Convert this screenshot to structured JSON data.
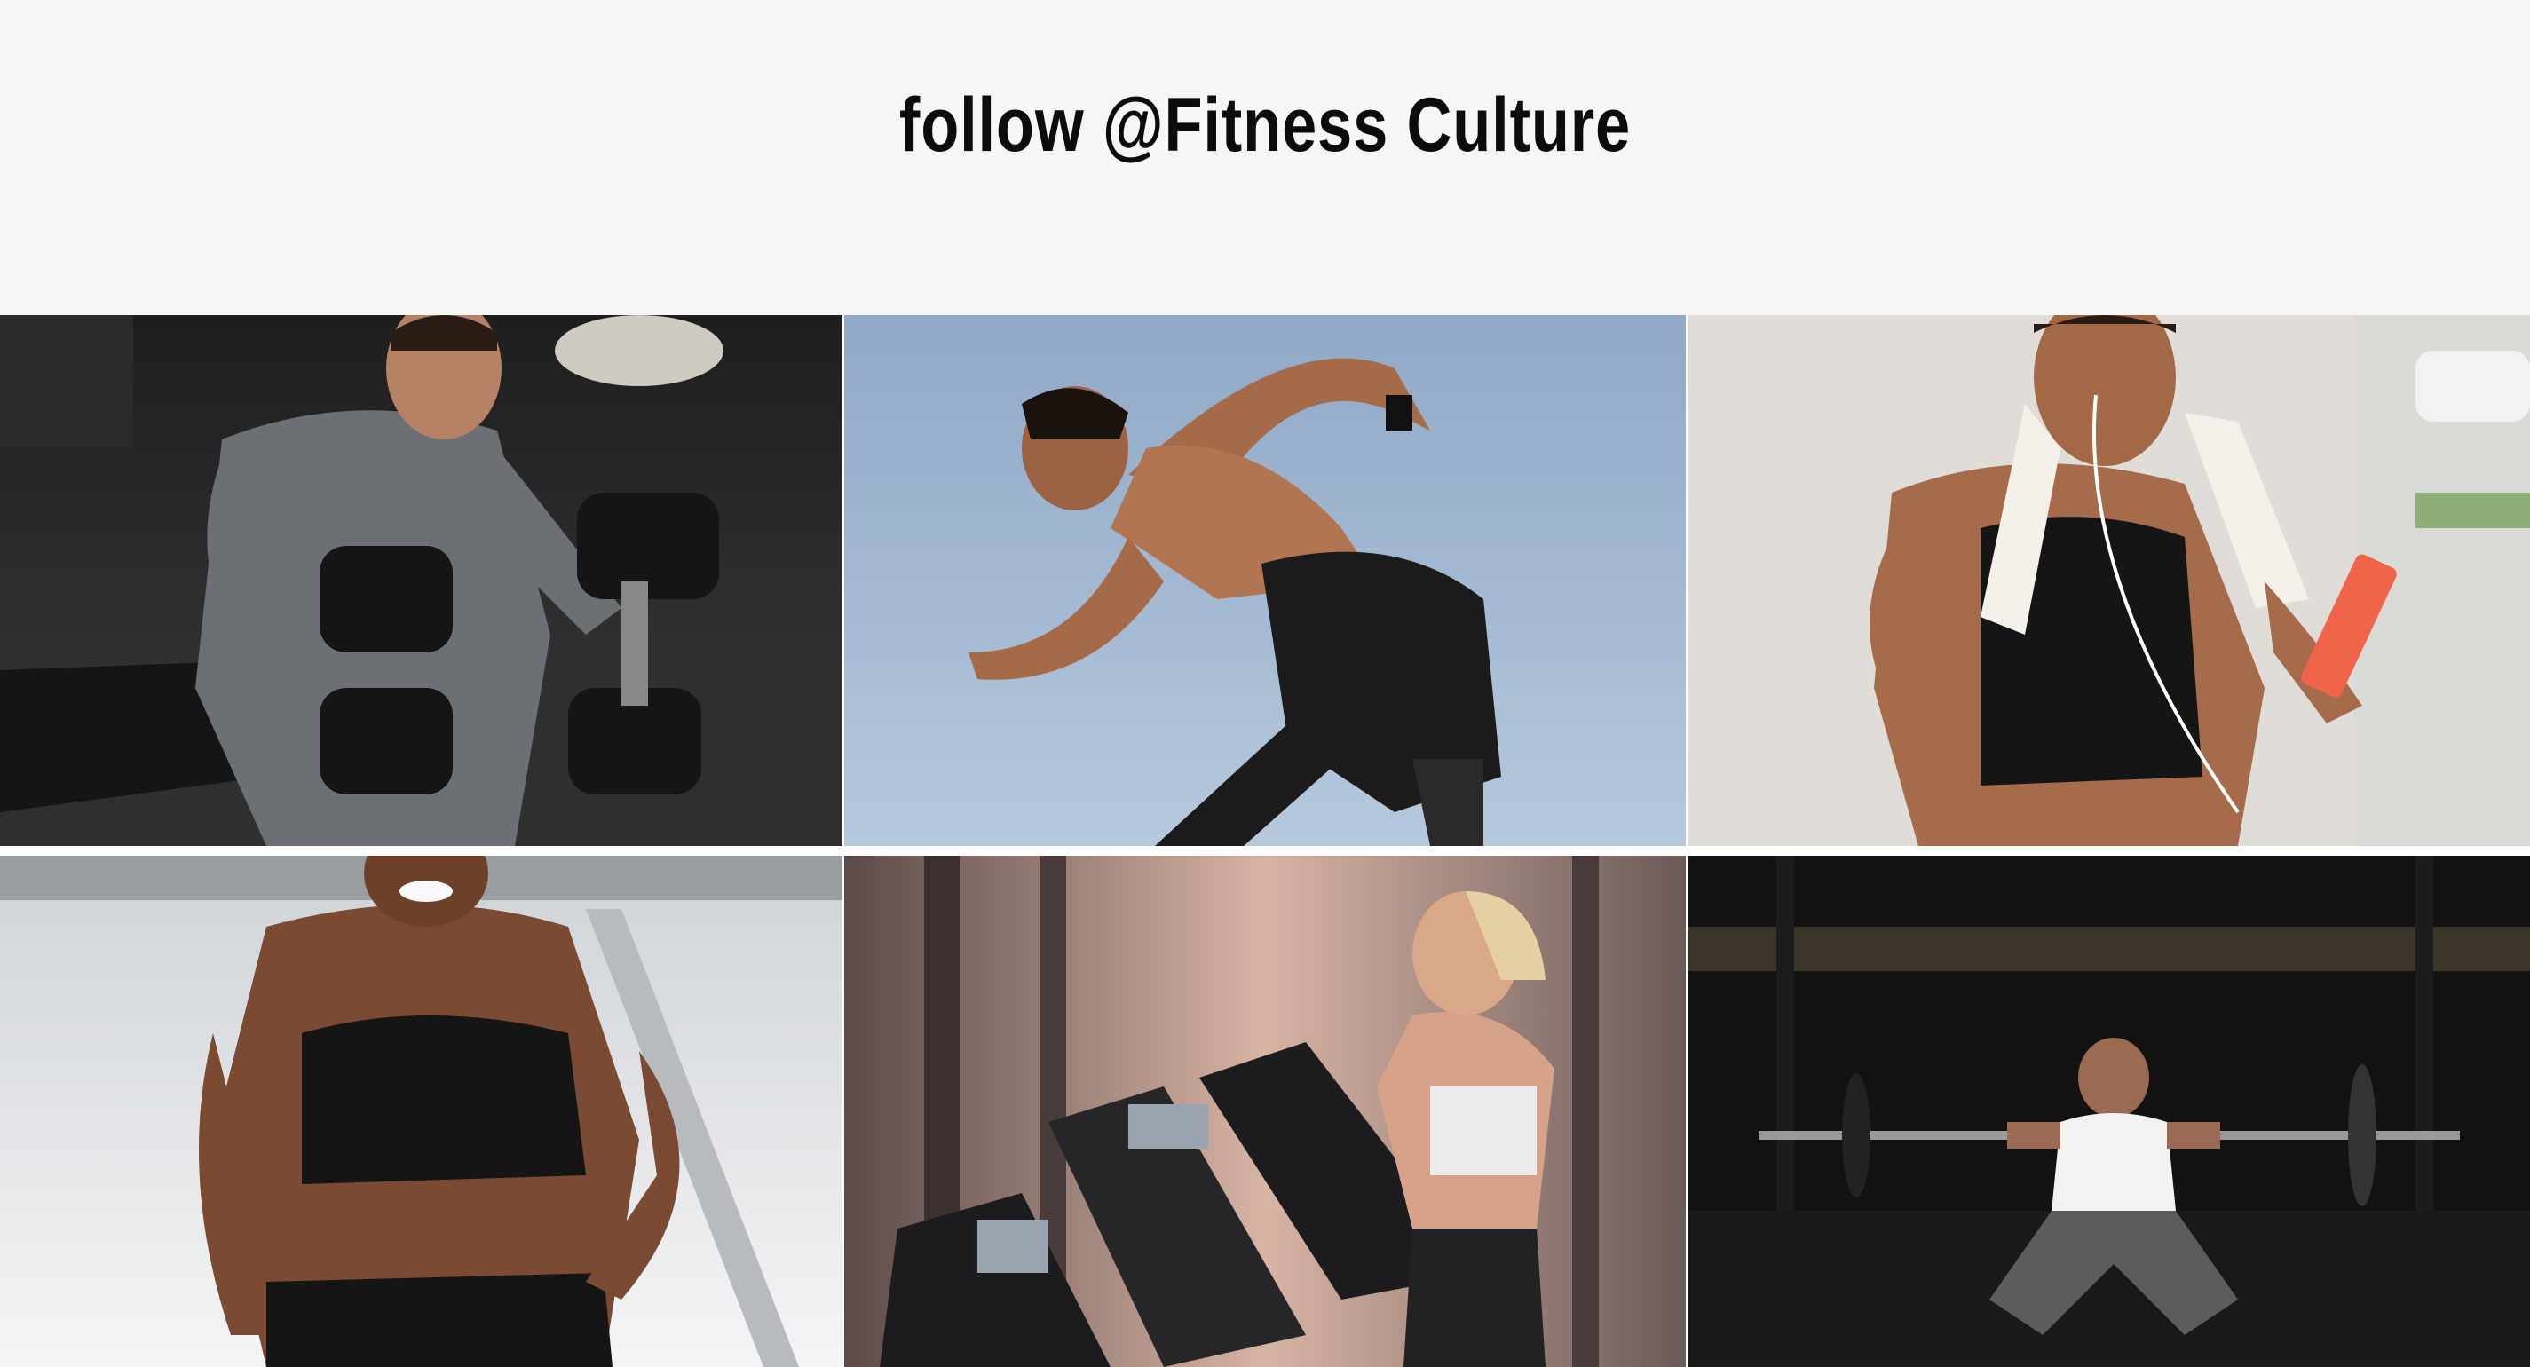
{
  "header": {
    "title": "follow @Fitness Culture"
  },
  "gallery": {
    "photos": [
      {
        "subject": "man lifting dumbbells in dark gym"
      },
      {
        "subject": "shirtless man sprinting against blue sky"
      },
      {
        "subject": "woman with towel and earphones holding phone"
      },
      {
        "subject": "smiling woman running up stairs"
      },
      {
        "subject": "woman on treadmill in gym"
      },
      {
        "subject": "woman doing barbell front squat in dark gym"
      }
    ]
  }
}
